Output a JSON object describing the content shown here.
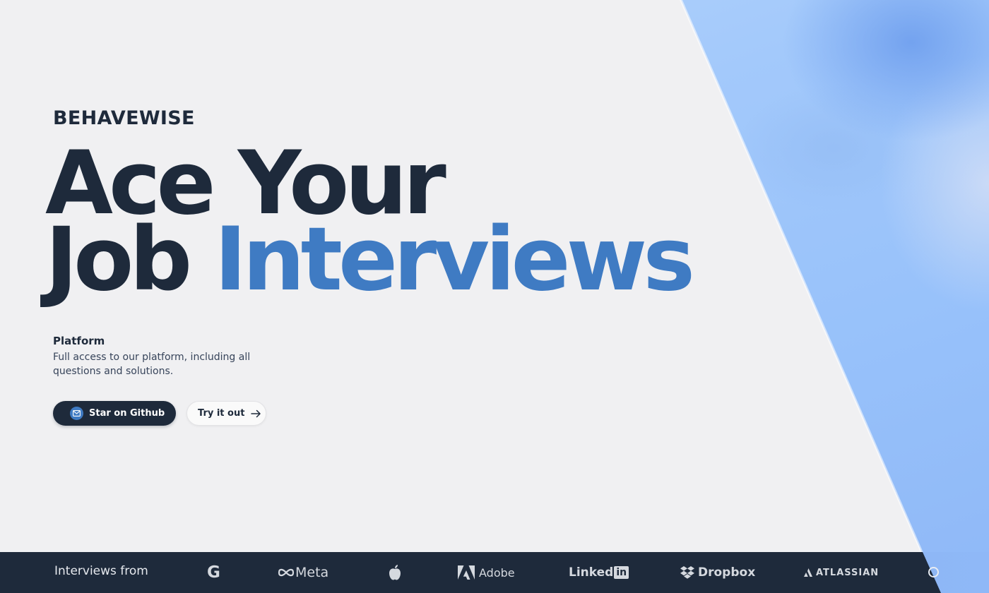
{
  "brand": {
    "name": "BEHAVEWISE"
  },
  "hero": {
    "line1": "Ace Your",
    "line2_part1": "Job",
    "line2_accent": "Interviews"
  },
  "feature": {
    "title": "Platform",
    "description": "Full access to our platform, including all questions and solutions."
  },
  "actions": {
    "primary_label": "Star on Github",
    "primary_icon": "mail-icon",
    "secondary_label": "Try it out",
    "secondary_icon": "arrow-right-icon"
  },
  "footer": {
    "label": "Interviews from",
    "logos": {
      "google": "G",
      "meta": "Meta",
      "apple": "apple-icon",
      "adobe": "Adobe",
      "linkedin_text": "Linked",
      "linkedin_box": "in",
      "dropbox": "Dropbox",
      "atlassian": "ATLASSIAN"
    }
  },
  "colors": {
    "navy": "#1e2a3b",
    "accent_blue": "#3f7bc3",
    "background": "#f0f0f2",
    "panel_blue": "#a3c9fb"
  }
}
